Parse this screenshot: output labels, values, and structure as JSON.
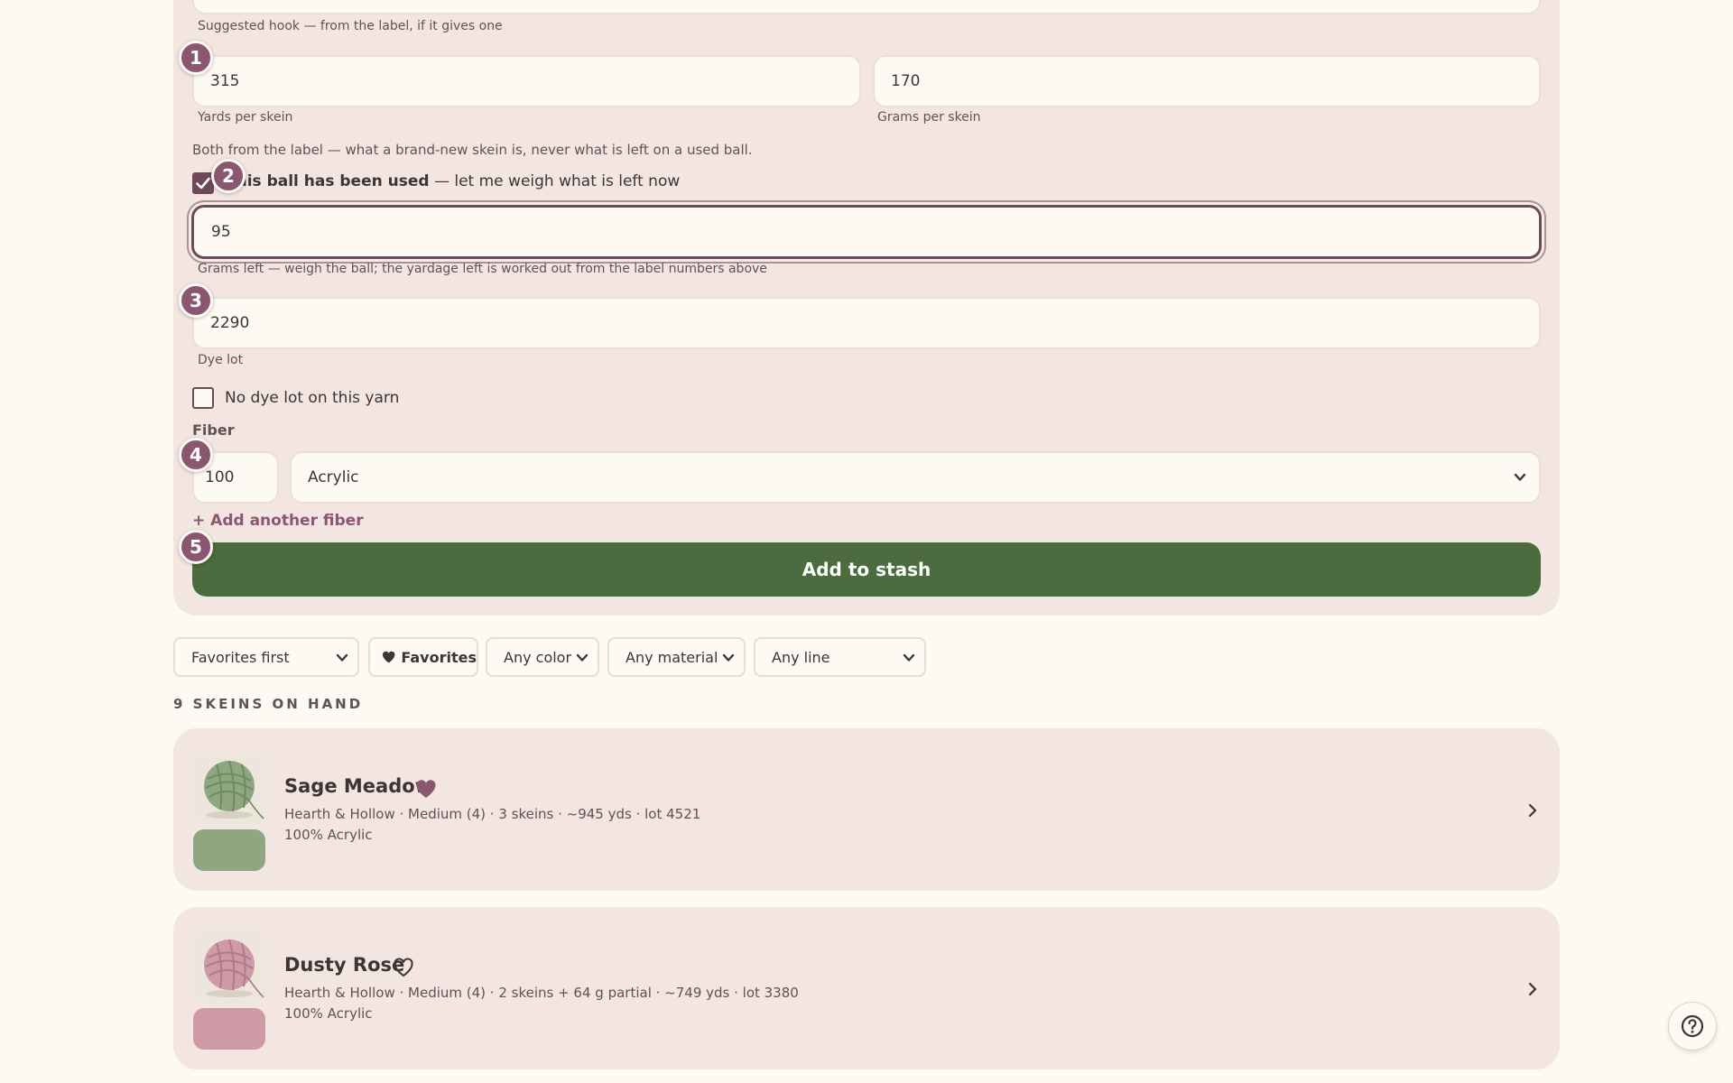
{
  "form": {
    "hook_help": "Suggested hook — from the label, if it gives one",
    "yards_value": "315",
    "yards_help": "Yards per skein",
    "grams_value": "170",
    "grams_help": "Grams per skein",
    "label_note": "Both from the label — what a brand-new skein is, never what is left on a used ball.",
    "used_checkbox": {
      "checked": true,
      "label_bold": "This ball has been used",
      "label_rest": " — let me weigh what is left now"
    },
    "grams_left_value": "95",
    "grams_left_help": "Grams left — weigh the ball; the yardage left is worked out from the label numbers above",
    "dye_lot_value": "2290",
    "dye_lot_help": "Dye lot",
    "no_dye_lot": {
      "checked": false,
      "label": "No dye lot on this yarn"
    },
    "fiber_heading": "Fiber",
    "fiber_percent": "100",
    "fiber_material": "Acrylic",
    "add_fiber_label": "+ Add another fiber",
    "submit_label": "Add to stash"
  },
  "badges": [
    "1",
    "2",
    "3",
    "4",
    "5"
  ],
  "filters": {
    "sort": "Favorites first",
    "favorites": "Favorites",
    "color": "Any color",
    "material": "Any material",
    "line": "Any line"
  },
  "stash_heading": "9 SKEINS ON HAND",
  "skeins": [
    {
      "name": "Sage Meadow",
      "favorite": true,
      "meta": "Hearth & Hollow · Medium (4) · 3 skeins · ~945 yds · lot 4521",
      "fiber": "100% Acrylic",
      "color": "#8fa781"
    },
    {
      "name": "Dusty Rose",
      "favorite": false,
      "meta": "Hearth & Hollow · Medium (4) · 2 skeins + 64 g partial · ~749 yds · lot 3380",
      "fiber": "100% Acrylic",
      "color": "#cf9aa8"
    }
  ],
  "colors": {
    "accent": "#8a5670",
    "primary": "#4c6c3f",
    "panel": "#f3e6e1",
    "background": "#fdfaf4"
  }
}
